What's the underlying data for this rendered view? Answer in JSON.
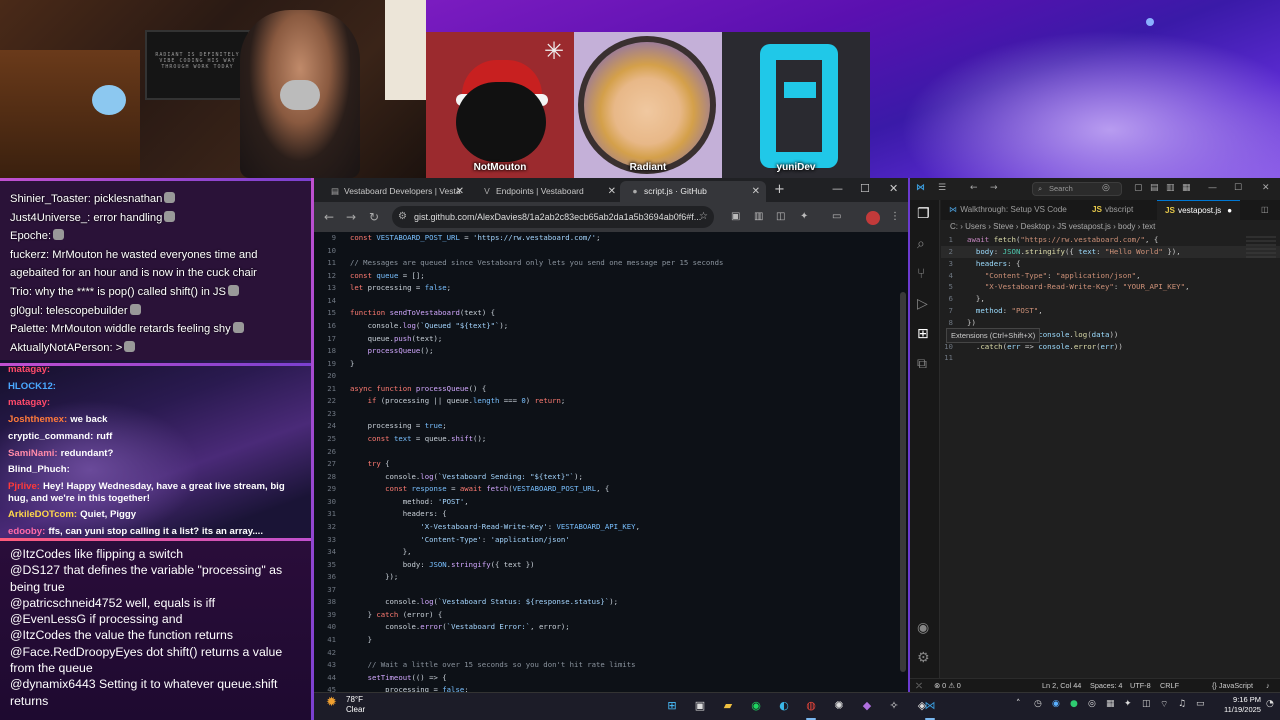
{
  "webcam": {
    "sign_text": "RADIANT IS DEFINITELY VIBE CODING HIS WAY THROUGH WORK TODAY"
  },
  "avatars": [
    {
      "name": "NotMouton"
    },
    {
      "name": "Radiant"
    },
    {
      "name": "yuniDev"
    }
  ],
  "chat_top": [
    {
      "text": "Shinier_Toaster: picklesnathan"
    },
    {
      "text": "Just4Universe_: error handling"
    },
    {
      "text": "Epoche:"
    },
    {
      "text": "fuckerz: MrMouton he wasted everyones time and"
    },
    {
      "text": "agebaited for an hour and is now in the cuck chair"
    },
    {
      "text": "Trio: why the **** is pop() called shift() in JS"
    },
    {
      "text": "gl0gul: telescopebuilder"
    },
    {
      "text": "Palette: MrMouton widdle retards feeling shy"
    },
    {
      "text": "AktuallyNotAPerson: >"
    }
  ],
  "chat_mid": [
    {
      "user": "matagay:",
      "msg": "",
      "ucolor": "#ff4a6a"
    },
    {
      "user": "HLOCK12:",
      "msg": "",
      "ucolor": "#4aa8ff"
    },
    {
      "user": "matagay:",
      "msg": "",
      "ucolor": "#ff4a6a"
    },
    {
      "user": "Joshthemex:",
      "msg": "we back",
      "ucolor": "#ff7a3a"
    },
    {
      "user": "cryptic_command:",
      "msg": "ruff",
      "ucolor": "#ffffff"
    },
    {
      "user": "SamiNami:",
      "msg": "redundant?",
      "ucolor": "#ff8aa8"
    },
    {
      "user": "Blind_Phuch:",
      "msg": "",
      "ucolor": "#ffffff"
    },
    {
      "user": "Pjrlive:",
      "msg": "Hey! Happy Wednesday, have a great live stream, big hug, and we're in this together!",
      "ucolor": "#ff3a3a"
    },
    {
      "user": "ArkileDOTcom:",
      "msg": "Quiet, Piggy",
      "ucolor": "#ffd84a"
    },
    {
      "user": "edooby:",
      "msg": "ffs, can yuni stop calling it a list? its an array....",
      "ucolor": "#ff6aa8"
    }
  ],
  "chat_bottom": [
    {
      "mention": "@ItzCodes",
      "text": " like flipping a switch"
    },
    {
      "mention": "@DS127",
      "text": " that defines the variable \"processing\" as being true"
    },
    {
      "mention": "@patricschneid4752",
      "text": " well, equals is iff"
    },
    {
      "mention": "@EvenLessG",
      "text": " if processing and"
    },
    {
      "mention": "@ItzCodes",
      "text": " the value the function returns"
    },
    {
      "mention": "@Face.RedDroopyEyes",
      "text": " dot shift() returns a value from the queue"
    },
    {
      "mention": "@dynamix6443",
      "text": " Setting it to whatever queue.shift returns"
    }
  ],
  "browser": {
    "tabs": [
      {
        "label": "Vestaboard Developers | Vesta"
      },
      {
        "label": "Endpoints | Vestaboard"
      },
      {
        "label": "script.js · GitHub"
      }
    ],
    "url": "gist.github.com/AlexDavies8/1a2ab2c83ecb65ab2da1a5b3694ab0f6#f...",
    "new_tab": "+"
  },
  "code_lines": [
    {
      "n": "9",
      "html": "<span class='k'>const</span> <span class='v'>VESTABOARD_POST_URL</span> = <span class='s'>'https://rw.vestaboard.com/'</span>;"
    },
    {
      "n": "10",
      "html": ""
    },
    {
      "n": "11",
      "html": "<span class='c'>// Messages are queued since Vestaboard only lets you send one message per 15 seconds</span>"
    },
    {
      "n": "12",
      "html": "<span class='k'>const</span> <span class='v'>queue</span> = [];"
    },
    {
      "n": "13",
      "html": "<span class='k'>let</span> processing = <span class='v'>false</span>;"
    },
    {
      "n": "14",
      "html": ""
    },
    {
      "n": "15",
      "html": "<span class='k'>function</span> <span class='f'>sendToVestaboard</span>(text) {"
    },
    {
      "n": "16",
      "html": "    console.<span class='f'>log</span>(<span class='s'>`Queued \"${text}\"`</span>);"
    },
    {
      "n": "17",
      "html": "    queue.<span class='f'>push</span>(text);"
    },
    {
      "n": "18",
      "html": "    <span class='f'>processQueue</span>();"
    },
    {
      "n": "19",
      "html": "}"
    },
    {
      "n": "20",
      "html": ""
    },
    {
      "n": "21",
      "html": "<span class='k'>async function</span> <span class='f'>processQueue</span>() {"
    },
    {
      "n": "22",
      "html": "    <span class='k'>if</span> (processing || queue.<span class='v'>length</span> === <span class='v'>0</span>) <span class='k'>return</span>;"
    },
    {
      "n": "23",
      "html": ""
    },
    {
      "n": "24",
      "html": "    processing = <span class='v'>true</span>;"
    },
    {
      "n": "25",
      "html": "    <span class='k'>const</span> <span class='v'>text</span> = queue.<span class='f'>shift</span>();"
    },
    {
      "n": "26",
      "html": ""
    },
    {
      "n": "27",
      "html": "    <span class='k'>try</span> {"
    },
    {
      "n": "28",
      "html": "        console.<span class='f'>log</span>(<span class='s'>`Vestaboard Sending: \"${text}\"`</span>);"
    },
    {
      "n": "29",
      "html": "        <span class='k'>const</span> <span class='v'>response</span> = <span class='k'>await</span> <span class='f'>fetch</span>(<span class='v'>VESTABOARD_POST_URL</span>, {"
    },
    {
      "n": "30",
      "html": "            method: <span class='s'>'POST'</span>,"
    },
    {
      "n": "31",
      "html": "            headers: {"
    },
    {
      "n": "32",
      "html": "                <span class='s'>'X-Vestaboard-Read-Write-Key'</span>: <span class='v'>VESTABOARD_API_KEY</span>,"
    },
    {
      "n": "33",
      "html": "                <span class='s'>'Content-Type'</span>: <span class='s'>'application/json'</span>"
    },
    {
      "n": "34",
      "html": "            },"
    },
    {
      "n": "35",
      "html": "            body: <span class='v'>JSON</span>.<span class='f'>stringify</span>({ text })"
    },
    {
      "n": "36",
      "html": "        });"
    },
    {
      "n": "37",
      "html": ""
    },
    {
      "n": "38",
      "html": "        console.<span class='f'>log</span>(<span class='s'>`Vestaboard Status: ${response.status}`</span>);"
    },
    {
      "n": "39",
      "html": "    } <span class='k'>catch</span> (error) {"
    },
    {
      "n": "40",
      "html": "        console.<span class='f'>error</span>(<span class='s'>`Vestaboard Error:`</span>, error);"
    },
    {
      "n": "41",
      "html": "    }"
    },
    {
      "n": "42",
      "html": ""
    },
    {
      "n": "43",
      "html": "    <span class='c'>// Wait a little over 15 seconds so you don't hit rate limits</span>"
    },
    {
      "n": "44",
      "html": "    <span class='f'>setTimeout</span>(() => {"
    },
    {
      "n": "45",
      "html": "        processing = <span class='v'>false</span>;"
    }
  ],
  "vscode": {
    "search": "Search",
    "tabs": [
      {
        "label": "Walkthrough: Setup VS Code"
      },
      {
        "label": "vbscript"
      },
      {
        "label": "vestapost.js"
      }
    ],
    "breadcrumbs": "C: › Users › Steve › Desktop › JS vestapost.js › body › text",
    "tooltip": "Extensions (Ctrl+Shift+X)",
    "status": {
      "errors": "⊗ 0 ⚠ 0",
      "position": "Ln 2, Col 44",
      "spaces": "Spaces: 4",
      "encoding": "UTF-8",
      "eol": "CRLF",
      "lang": "{} JavaScript"
    }
  },
  "vs_lines": [
    {
      "n": "1",
      "html": "<span class='vk'>await</span> <span class='vf'>fetch</span>(<span class='vs'>\"https://rw.vestaboard.com/\"</span>, {"
    },
    {
      "n": "2",
      "html": "  <span class='vv'>body</span>: <span class='vc'>JSON</span>.<span class='vf'>stringify</span>({ <span class='vv'>text</span>: <span class='vs'>\"Hello World\"</span> }),"
    },
    {
      "n": "3",
      "html": "  <span class='vv'>headers</span>: {"
    },
    {
      "n": "4",
      "html": "    <span class='vs'>\"Content-Type\"</span>: <span class='vs'>\"application/json\"</span>,"
    },
    {
      "n": "5",
      "html": "    <span class='vs'>\"X-Vestaboard-Read-Write-Key\"</span>: <span class='vs'>\"YOUR_API_KEY\"</span>,"
    },
    {
      "n": "6",
      "html": "  },"
    },
    {
      "n": "7",
      "html": "  <span class='vv'>method</span>: <span class='vs'>\"POST\"</span>,"
    },
    {
      "n": "8",
      "html": "})"
    },
    {
      "n": "9",
      "html": "  .<span class='vf'>then</span>(<span class='vv'>data</span> => <span class='vv'>console</span>.<span class='vf'>log</span>(<span class='vv'>data</span>))"
    },
    {
      "n": "10",
      "html": "  .<span class='vf'>catch</span>(<span class='vv'>err</span> => <span class='vv'>console</span>.<span class='vf'>error</span>(<span class='vv'>err</span>))"
    },
    {
      "n": "11",
      "html": ""
    }
  ],
  "taskbar": {
    "temp": "78°F",
    "condition": "Clear",
    "time": "9:16 PM",
    "date": "11/19/2025"
  }
}
